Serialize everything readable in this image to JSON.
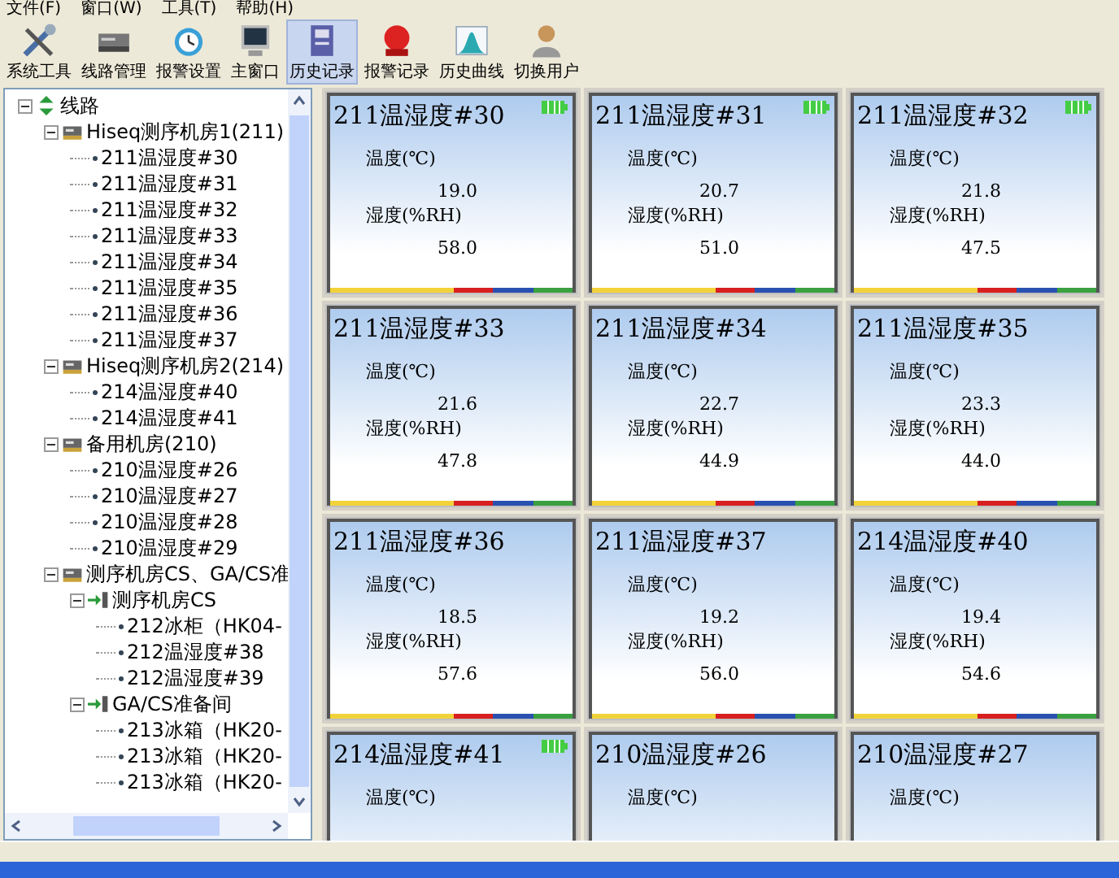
{
  "menu": [
    "文件(F)",
    "窗口(W)",
    "工具(T)",
    "帮助(H)"
  ],
  "toolbar": [
    {
      "label": "系统工具",
      "selected": false
    },
    {
      "label": "线路管理",
      "selected": false
    },
    {
      "label": "报警设置",
      "selected": false
    },
    {
      "label": "主窗口",
      "selected": false
    },
    {
      "label": "历史记录",
      "selected": true
    },
    {
      "label": "报警记录",
      "selected": false
    },
    {
      "label": "历史曲线",
      "selected": false
    },
    {
      "label": "切换用户",
      "selected": false
    }
  ],
  "tree": [
    {
      "label": "线路",
      "kind": "root",
      "expanded": true,
      "children": [
        {
          "label": "Hiseq测序机房1(211)",
          "kind": "group",
          "expanded": true,
          "children": [
            {
              "label": "211温湿度#30",
              "kind": "sensor"
            },
            {
              "label": "211温湿度#31",
              "kind": "sensor"
            },
            {
              "label": "211温湿度#32",
              "kind": "sensor"
            },
            {
              "label": "211温湿度#33",
              "kind": "sensor"
            },
            {
              "label": "211温湿度#34",
              "kind": "sensor"
            },
            {
              "label": "211温湿度#35",
              "kind": "sensor"
            },
            {
              "label": "211温湿度#36",
              "kind": "sensor"
            },
            {
              "label": "211温湿度#37",
              "kind": "sensor"
            }
          ]
        },
        {
          "label": "Hiseq测序机房2(214)",
          "kind": "group",
          "expanded": true,
          "children": [
            {
              "label": "214温湿度#40",
              "kind": "sensor"
            },
            {
              "label": "214温湿度#41",
              "kind": "sensor"
            }
          ]
        },
        {
          "label": "备用机房(210)",
          "kind": "group",
          "expanded": true,
          "children": [
            {
              "label": "210温湿度#26",
              "kind": "sensor"
            },
            {
              "label": "210温湿度#27",
              "kind": "sensor"
            },
            {
              "label": "210温湿度#28",
              "kind": "sensor"
            },
            {
              "label": "210温湿度#29",
              "kind": "sensor"
            }
          ]
        },
        {
          "label": "测序机房CS、GA/CS准",
          "kind": "group",
          "expanded": true,
          "children": [
            {
              "label": "测序机房CS",
              "kind": "subgroup",
              "expanded": true,
              "children": [
                {
                  "label": "212冰柜（HK04-",
                  "kind": "sensor"
                },
                {
                  "label": "212温湿度#38",
                  "kind": "sensor"
                },
                {
                  "label": "212温湿度#39",
                  "kind": "sensor"
                }
              ]
            },
            {
              "label": "GA/CS准备间",
              "kind": "subgroup",
              "expanded": true,
              "children": [
                {
                  "label": "213冰箱（HK20-",
                  "kind": "sensor"
                },
                {
                  "label": "213冰箱（HK20-",
                  "kind": "sensor"
                },
                {
                  "label": "213冰箱（HK20-",
                  "kind": "sensor"
                }
              ]
            }
          ]
        }
      ]
    }
  ],
  "cards": [
    {
      "title": "211温湿度#30",
      "battery": true,
      "temp_label": "温度(℃)",
      "temp": "19.0",
      "hum_label": "湿度(%RH)",
      "hum": "58.0"
    },
    {
      "title": "211温湿度#31",
      "battery": true,
      "temp_label": "温度(℃)",
      "temp": "20.7",
      "hum_label": "湿度(%RH)",
      "hum": "51.0"
    },
    {
      "title": "211温湿度#32",
      "battery": true,
      "temp_label": "温度(℃)",
      "temp": "21.8",
      "hum_label": "湿度(%RH)",
      "hum": "47.5"
    },
    {
      "title": "211温湿度#33",
      "battery": false,
      "temp_label": "温度(℃)",
      "temp": "21.6",
      "hum_label": "湿度(%RH)",
      "hum": "47.8"
    },
    {
      "title": "211温湿度#34",
      "battery": false,
      "temp_label": "温度(℃)",
      "temp": "22.7",
      "hum_label": "湿度(%RH)",
      "hum": "44.9"
    },
    {
      "title": "211温湿度#35",
      "battery": false,
      "temp_label": "温度(℃)",
      "temp": "23.3",
      "hum_label": "湿度(%RH)",
      "hum": "44.0"
    },
    {
      "title": "211温湿度#36",
      "battery": false,
      "temp_label": "温度(℃)",
      "temp": "18.5",
      "hum_label": "湿度(%RH)",
      "hum": "57.6"
    },
    {
      "title": "211温湿度#37",
      "battery": false,
      "temp_label": "温度(℃)",
      "temp": "19.2",
      "hum_label": "湿度(%RH)",
      "hum": "56.0"
    },
    {
      "title": "214温湿度#40",
      "battery": false,
      "temp_label": "温度(℃)",
      "temp": "19.4",
      "hum_label": "湿度(%RH)",
      "hum": "54.6"
    },
    {
      "title": "214温湿度#41",
      "battery": true,
      "temp_label": "温度(℃)"
    },
    {
      "title": "210温湿度#26",
      "battery": false,
      "temp_label": "温度(℃)"
    },
    {
      "title": "210温湿度#27",
      "battery": false,
      "temp_label": "温度(℃)"
    }
  ]
}
